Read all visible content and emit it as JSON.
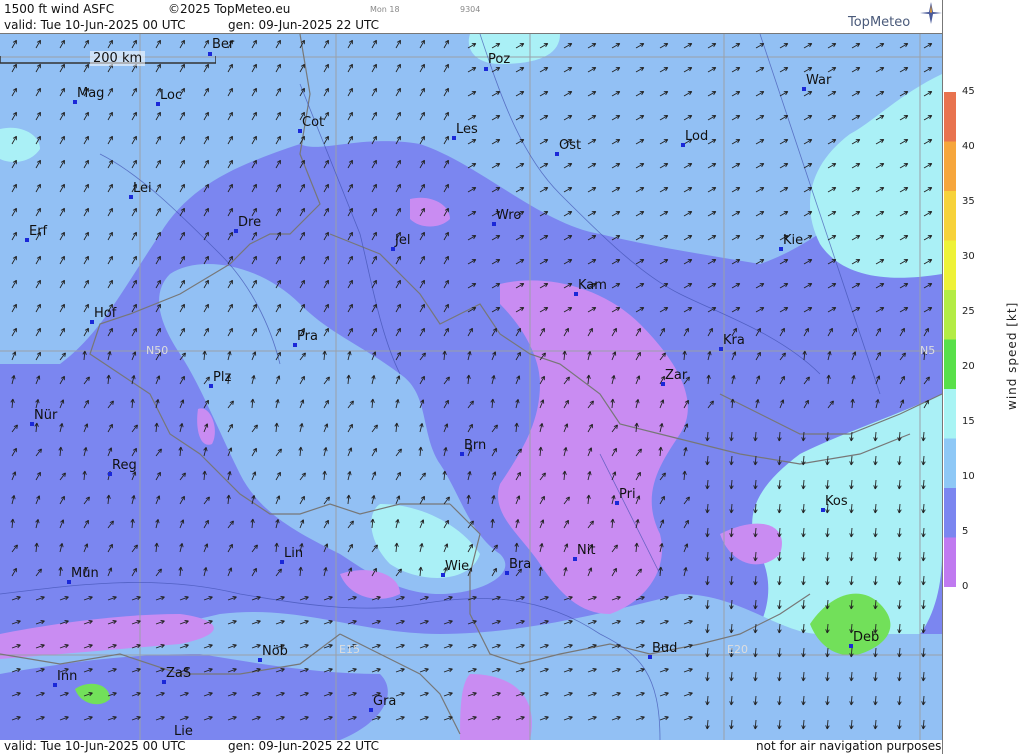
{
  "header": {
    "product": "1500 ft wind ASFC",
    "copyright": "©2025 TopMeteo.eu",
    "model_tag": "Mon 18",
    "code_tag": "9304",
    "valid": "valid:  Tue  10-Jun-2025  00 UTC",
    "generated": "gen:  09-Jun-2025 22 UTC",
    "logo": "TopMeteo"
  },
  "footer": {
    "valid": "valid:  Tue  10-Jun-2025  00 UTC",
    "generated": "gen:  09-Jun-2025 22 UTC",
    "disclaimer": "not for air navigation purposes"
  },
  "scale": {
    "label": "200 km"
  },
  "grid_labels": {
    "n50_left": "N50",
    "n50_right": "N5",
    "e15": "E15",
    "e20": "E20"
  },
  "cities": [
    {
      "key": "ber",
      "name": "Ber"
    },
    {
      "key": "poz",
      "name": "Poz"
    },
    {
      "key": "war",
      "name": "War"
    },
    {
      "key": "mag",
      "name": "Mag"
    },
    {
      "key": "loc",
      "name": "Loc"
    },
    {
      "key": "cot",
      "name": "Cot"
    },
    {
      "key": "les",
      "name": "Les"
    },
    {
      "key": "ost",
      "name": "Ost"
    },
    {
      "key": "lod",
      "name": "Lod"
    },
    {
      "key": "lei",
      "name": "Lei"
    },
    {
      "key": "wro",
      "name": "Wro"
    },
    {
      "key": "erf",
      "name": "Erf"
    },
    {
      "key": "dre",
      "name": "Dre"
    },
    {
      "key": "jel",
      "name": "Jel"
    },
    {
      "key": "kie",
      "name": "Kie"
    },
    {
      "key": "kam",
      "name": "Kam"
    },
    {
      "key": "hof",
      "name": "Hof"
    },
    {
      "key": "pra",
      "name": "Pra"
    },
    {
      "key": "kra",
      "name": "Kra"
    },
    {
      "key": "plz",
      "name": "Plz"
    },
    {
      "key": "zar",
      "name": "Zar"
    },
    {
      "key": "nur",
      "name": "Nür"
    },
    {
      "key": "brn",
      "name": "Brn"
    },
    {
      "key": "reg",
      "name": "Reg"
    },
    {
      "key": "pri",
      "name": "Pri"
    },
    {
      "key": "kos",
      "name": "Kos"
    },
    {
      "key": "lin",
      "name": "Lin"
    },
    {
      "key": "nit",
      "name": "Nit"
    },
    {
      "key": "mun",
      "name": "Mün"
    },
    {
      "key": "wie",
      "name": "Wie"
    },
    {
      "key": "bra",
      "name": "Bra"
    },
    {
      "key": "deb",
      "name": "Deb"
    },
    {
      "key": "nob",
      "name": "Nöb"
    },
    {
      "key": "bud",
      "name": "Bud"
    },
    {
      "key": "inn",
      "name": "Inn"
    },
    {
      "key": "zas",
      "name": "ZaS"
    },
    {
      "key": "gra",
      "name": "Gra"
    },
    {
      "key": "lie",
      "name": "Lie"
    }
  ],
  "legend": {
    "title": "wind  speed  [kt]",
    "ticks": [
      "45",
      "40",
      "35",
      "30",
      "25",
      "20",
      "15",
      "10",
      "5",
      "0"
    ],
    "colors": [
      "#e8734f",
      "#f6a63c",
      "#f7d23a",
      "#eef238",
      "#b3ec45",
      "#58e04a",
      "#a8f4f4",
      "#8ec8f6",
      "#7b86f0",
      "#c07af0"
    ]
  },
  "map_colors": {
    "calm_purple": "#c98cf2",
    "light_wind_blue": "#7b86f0",
    "moderate_blue": "#92c0f4",
    "fresh_cyan": "#aaf0f6",
    "strong_green": "#72e05a"
  }
}
